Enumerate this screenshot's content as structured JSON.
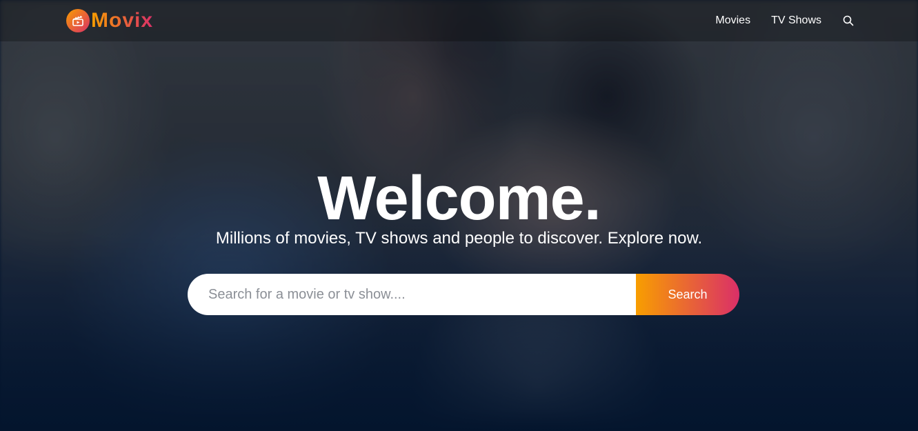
{
  "app": {
    "brand": "Movix",
    "brand_gradient": [
      "#f89e00",
      "#da2f68"
    ],
    "background_color": "#04152d"
  },
  "header": {
    "nav": [
      {
        "label": "Movies"
      },
      {
        "label": "TV Shows"
      }
    ],
    "search_icon": "search-icon"
  },
  "hero": {
    "title": "Welcome.",
    "subtitle": "Millions of movies, TV shows and people to discover. Explore now.",
    "search": {
      "placeholder": "Search for a movie or tv show....",
      "value": "",
      "button_label": "Search"
    }
  }
}
